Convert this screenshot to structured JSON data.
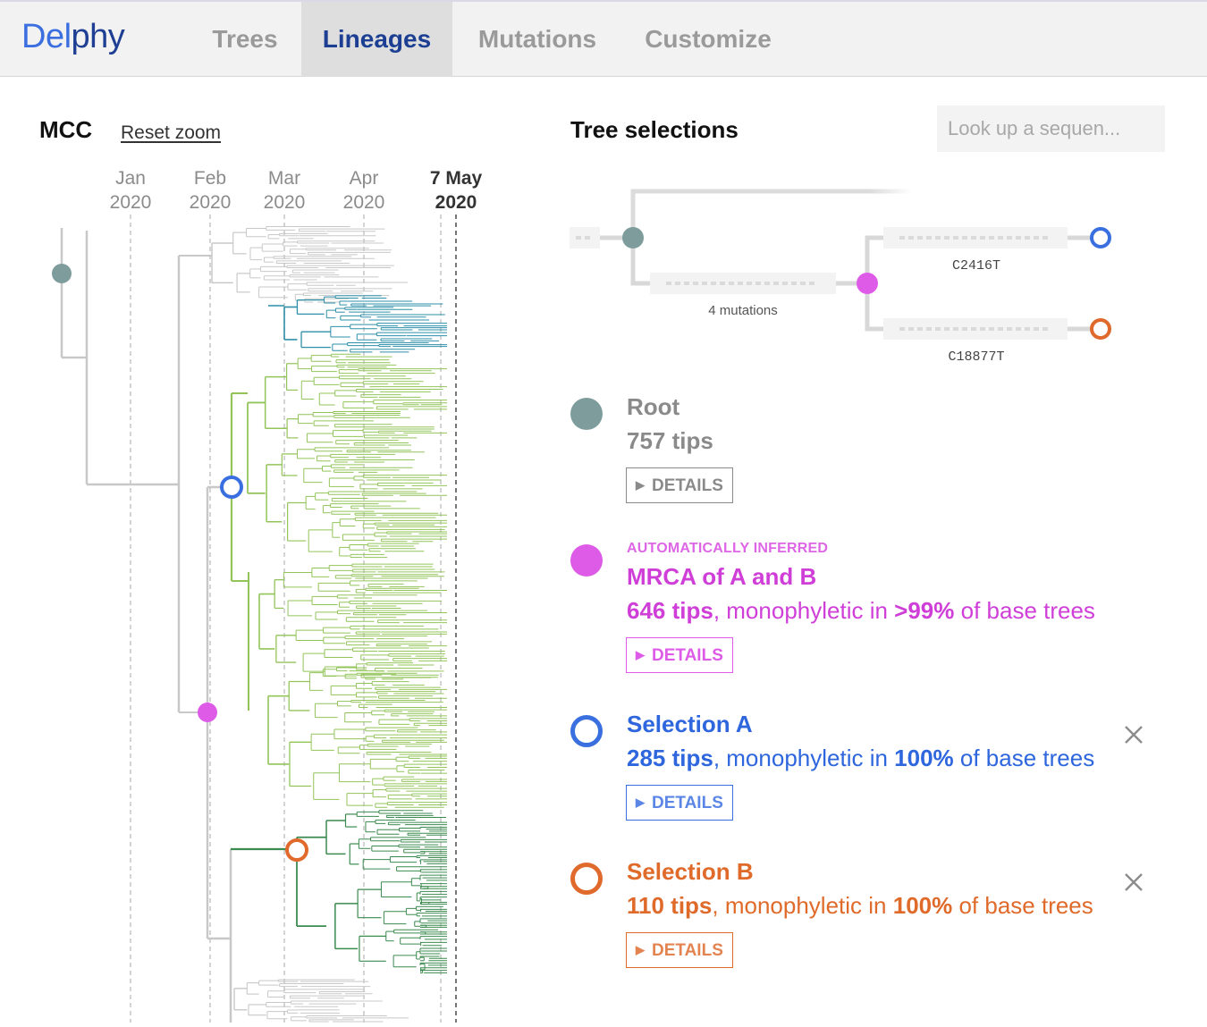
{
  "app": {
    "logo_a": "Del",
    "logo_b": "phy"
  },
  "nav": {
    "tabs": [
      {
        "label": "Trees",
        "active": false
      },
      {
        "label": "Lineages",
        "active": true
      },
      {
        "label": "Mutations",
        "active": false
      },
      {
        "label": "Customize",
        "active": false
      }
    ]
  },
  "left": {
    "title": "MCC",
    "reset_label": "Reset zoom",
    "axis": [
      {
        "month": "Jan",
        "year": "2020",
        "bold": false
      },
      {
        "month": "Feb",
        "year": "2020",
        "bold": false
      },
      {
        "month": "Mar",
        "year": "2020",
        "bold": false
      },
      {
        "month": "Apr",
        "year": "2020",
        "bold": false
      },
      {
        "month": "7 May",
        "year": "2020",
        "bold": true
      }
    ]
  },
  "right": {
    "title": "Tree selections",
    "search_placeholder": "Look up a sequen...",
    "mini_tree": {
      "mrca_label": "4 mutations",
      "a_mutation": "C2416T",
      "b_mutation": "C18877T"
    },
    "root": {
      "title": "Root",
      "tips": "757 tips",
      "details": "DETAILS"
    },
    "mrca": {
      "tag": "AUTOMATICALLY INFERRED",
      "title": "MRCA of A and B",
      "tips_bold": "646 tips",
      "tips_mid": ", monophyletic in ",
      "pct": ">99%",
      "tips_end": " of base trees",
      "details": "DETAILS"
    },
    "sel_a": {
      "title": "Selection A",
      "tips_bold": "285 tips",
      "tips_mid": ", monophyletic in ",
      "pct": "100%",
      "tips_end": " of base trees",
      "details": "DETAILS"
    },
    "sel_b": {
      "title": "Selection B",
      "tips_bold": "110 tips",
      "tips_mid": ", monophyletic in ",
      "pct": "100%",
      "tips_end": " of base trees",
      "details": "DETAILS"
    }
  },
  "colors": {
    "root": "#7f9c9c",
    "mrca": "#de5be8",
    "sel_a": "#3a6fe0",
    "sel_b": "#e06a2c",
    "light_green": "#93c45a",
    "dark_green": "#3b8a4f",
    "teal": "#2d8fa8",
    "grey": "#c8c8c8"
  }
}
